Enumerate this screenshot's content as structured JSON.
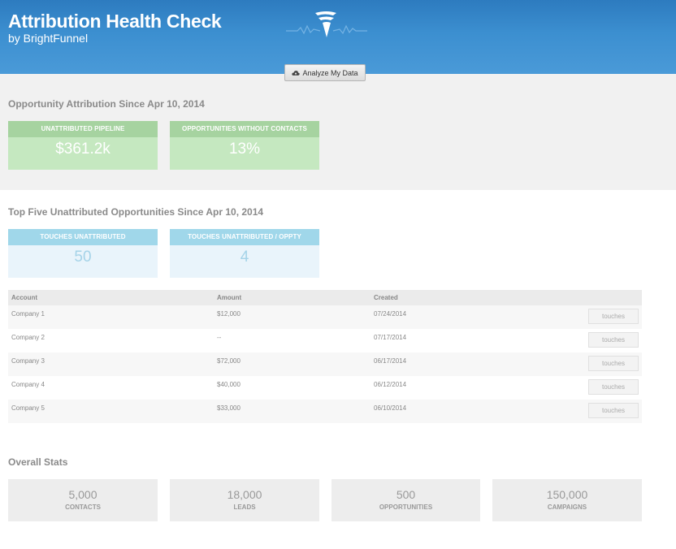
{
  "header": {
    "title": "Attribution Health Check",
    "subtitle": "by BrightFunnel",
    "logo_icon": "brightfunnel-logo-icon",
    "analyze_button": "Analyze My Data",
    "analyze_icon": "cloud-upload-icon"
  },
  "attribution": {
    "title": "Opportunity Attribution Since Apr 10, 2014",
    "cards": [
      {
        "label": "UNATTRIBUTED PIPELINE",
        "value": "$361.2k"
      },
      {
        "label": "OPPORTUNITIES WITHOUT CONTACTS",
        "value": "13%"
      }
    ]
  },
  "top_five": {
    "title": "Top Five Unattributed Opportunities Since Apr 10, 2014",
    "cards": [
      {
        "label": "TOUCHES UNATTRIBUTED",
        "value": "50"
      },
      {
        "label": "TOUCHES UNATTRIBUTED / OPPTY",
        "value": "4"
      }
    ]
  },
  "table": {
    "columns": [
      "Account",
      "Amount",
      "Created"
    ],
    "rows": [
      {
        "account": "Company 1",
        "amount": "$12,000",
        "created": "07/24/2014",
        "action": "touches"
      },
      {
        "account": "Company 2",
        "amount": "--",
        "created": "07/17/2014",
        "action": "touches"
      },
      {
        "account": "Company 3",
        "amount": "$72,000",
        "created": "06/17/2014",
        "action": "touches"
      },
      {
        "account": "Company 4",
        "amount": "$40,000",
        "created": "06/12/2014",
        "action": "touches"
      },
      {
        "account": "Company 5",
        "amount": "$33,000",
        "created": "06/10/2014",
        "action": "touches"
      }
    ]
  },
  "overall": {
    "title": "Overall Stats",
    "stats": [
      {
        "value": "5,000",
        "label": "CONTACTS"
      },
      {
        "value": "18,000",
        "label": "LEADS"
      },
      {
        "value": "500",
        "label": "OPPORTUNITIES"
      },
      {
        "value": "150,000",
        "label": "CAMPAIGNS"
      }
    ]
  },
  "colors": {
    "header_blue": "#3c8fd0",
    "green_head": "#a6d3a0",
    "green_body": "#c5e8c0",
    "blue_head": "#a0d7ea",
    "blue_body": "#e9f4fb"
  }
}
